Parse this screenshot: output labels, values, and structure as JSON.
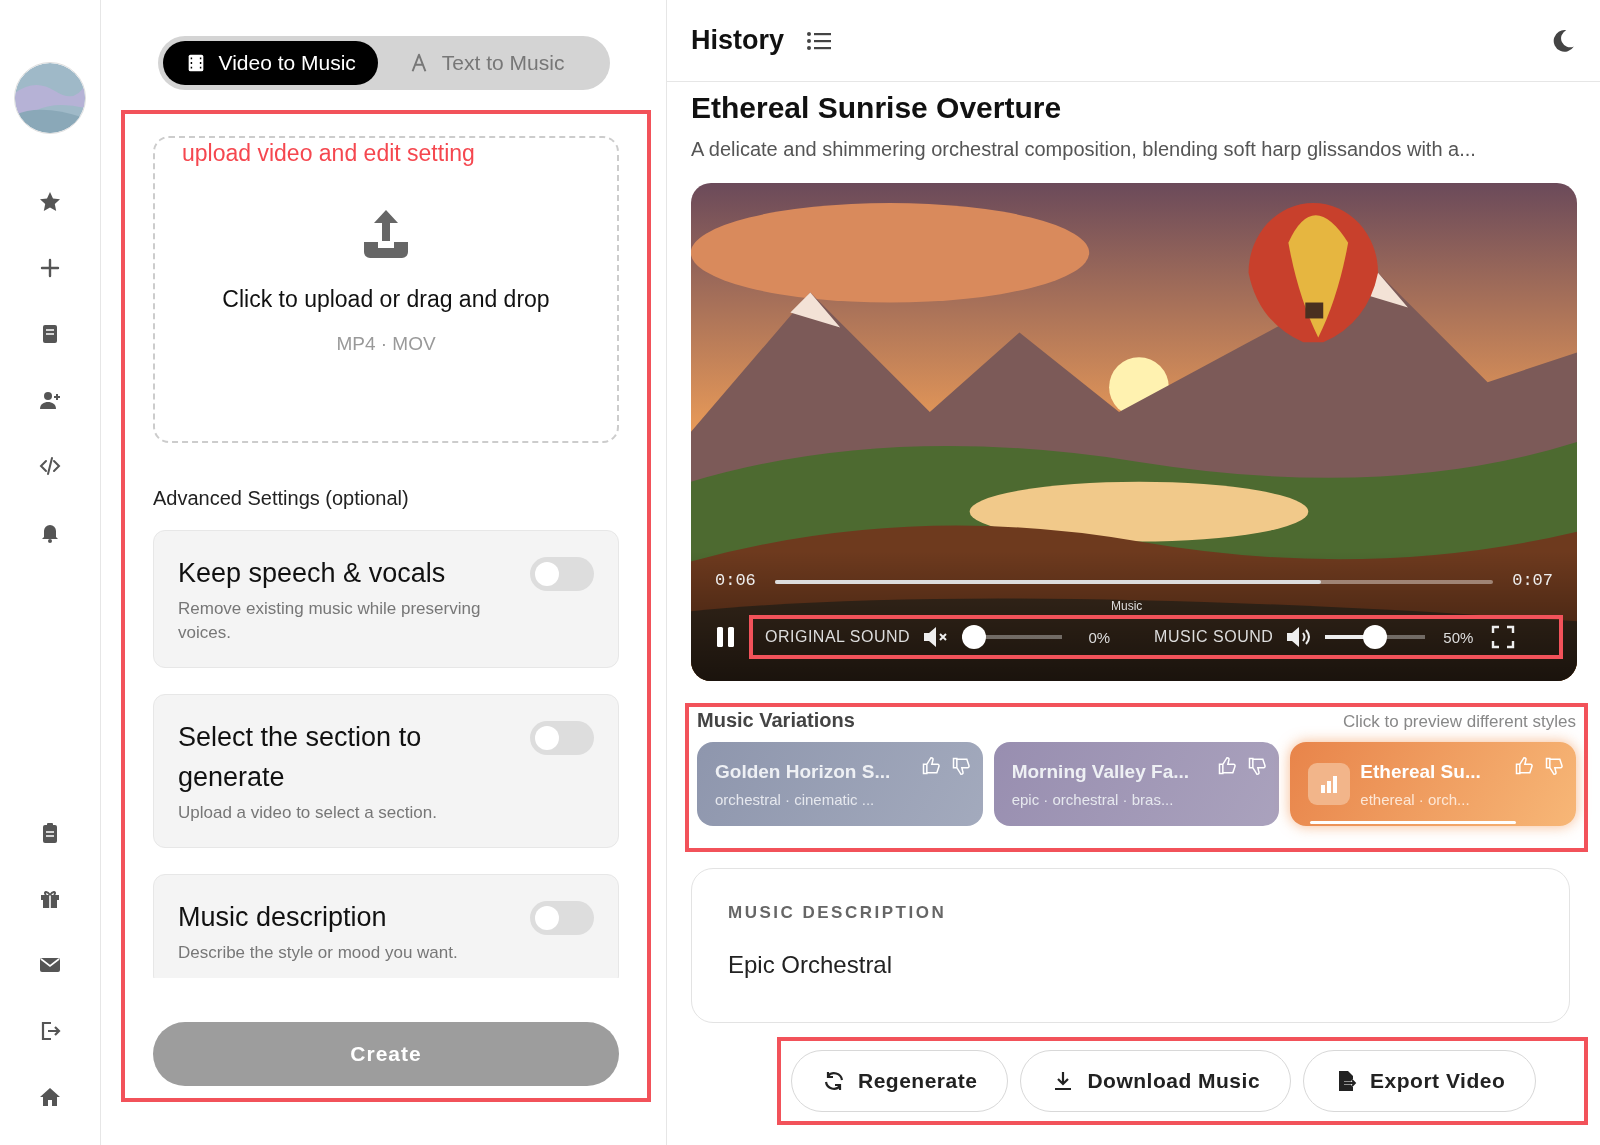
{
  "mode_tabs": [
    {
      "label": "Video to Music",
      "selected": true
    },
    {
      "label": "Text to Music",
      "selected": false
    }
  ],
  "annotation": "upload video and edit setting",
  "upload": {
    "title": "Click to upload or drag and drop",
    "formats": "MP4 · MOV"
  },
  "advanced_title": "Advanced Settings (optional)",
  "settings": [
    {
      "title": "Keep speech & vocals",
      "description": "Remove existing music while preserving voices.",
      "on": false
    },
    {
      "title": "Select the section to generate",
      "description": "Upload a video to select a section.",
      "on": false
    },
    {
      "title": "Music description",
      "description": "Describe the style or mood you want.",
      "on": false
    }
  ],
  "create_button": "Create",
  "history": {
    "title": "History"
  },
  "track": {
    "title": "Ethereal Sunrise Overture",
    "description": "A delicate and shimmering orchestral composition, blending soft harp glissandos with a..."
  },
  "player": {
    "current_time": "0:06",
    "duration": "0:07",
    "progress": {
      "level": 0.76
    },
    "playing": true,
    "overlay_label": "Music",
    "original_sound": {
      "label": "ORIGINAL SOUND",
      "muted": true,
      "level": 0,
      "reading": "0%"
    },
    "music_sound": {
      "label": "MUSIC SOUND",
      "muted": false,
      "level": 0.5,
      "reading": "50%"
    }
  },
  "variations": {
    "title": "Music Variations",
    "hint": "Click to preview different styles",
    "items": [
      {
        "name": "Golden Horizon S...",
        "tags": "orchestral · cinematic ...",
        "selected": false
      },
      {
        "name": "Morning Valley Fa...",
        "tags": "epic · orchestral · bras...",
        "selected": false
      },
      {
        "name": "Ethereal Su...",
        "tags": "ethereal · orch...",
        "selected": true
      }
    ]
  },
  "music_description": {
    "label": "MUSIC DESCRIPTION",
    "value": "Epic Orchestral"
  },
  "actions": [
    "Regenerate",
    "Download Music",
    "Export Video"
  ]
}
